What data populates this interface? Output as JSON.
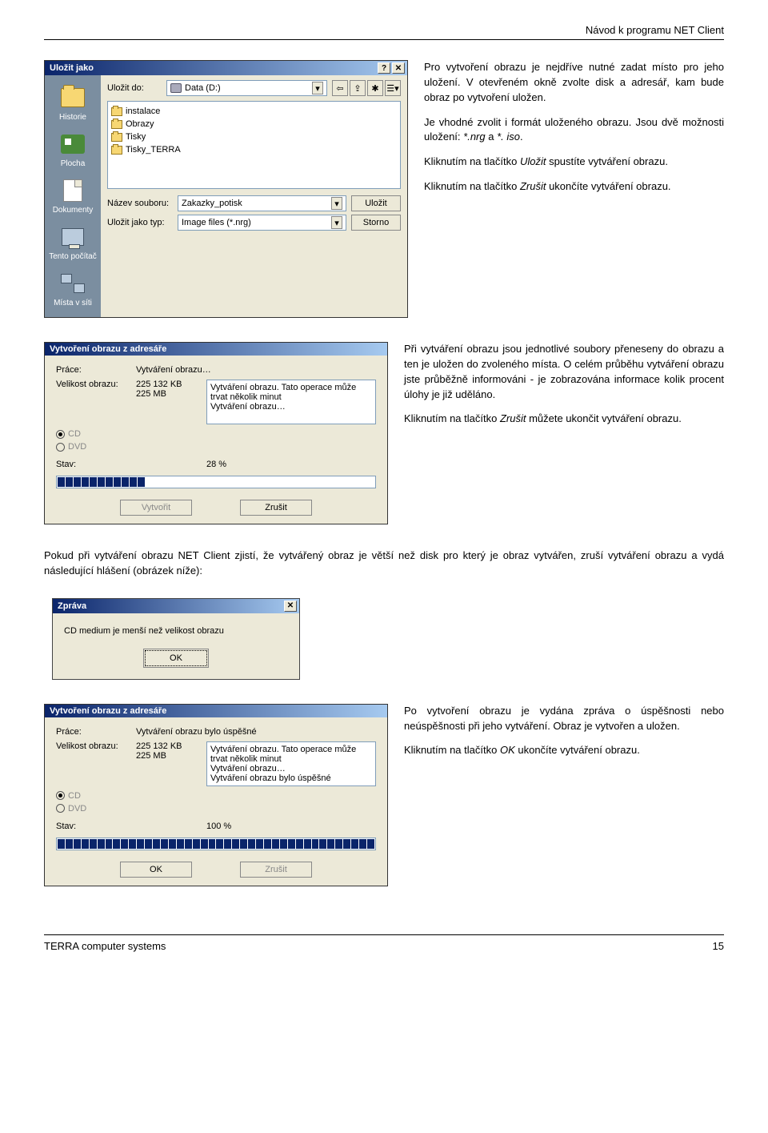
{
  "header": {
    "title": "Návod k programu NET Client"
  },
  "text": {
    "p1": "Pro vytvoření obrazu je nejdříve nutné zadat místo pro jeho uložení. V otevřeném okně zvolte disk a adresář, kam bude obraz po vytvoření uložen.",
    "p2a": "Je vhodné zvolit i formát uloženého obrazu. Jsou dvě možnosti uložení: ",
    "p2b": "*.nrg",
    "p2c": " a ",
    "p2d": "*. iso",
    "p2e": ".",
    "p3a": "Kliknutím na tlačítko ",
    "p3b": "Uložit",
    "p3c": " spustíte vytváření obrazu.",
    "p4a": "Kliknutím na tlačítko ",
    "p4b": "Zrušit",
    "p4c": " ukončíte vytváření obrazu.",
    "p5": "Při vytváření obrazu jsou jednotlivé soubory přeneseny do obrazu a ten je uložen do zvoleného místa. O celém průběhu vytváření obrazu jste průběžně informováni - je zobrazována informace kolik procent úlohy je již uděláno.",
    "p6a": "Kliknutím na tlačítko ",
    "p6b": "Zrušit",
    "p6c": " můžete ukončit vytváření obrazu.",
    "p7": "Pokud při vytváření obrazu NET Client zjistí, že vytvářený obraz je větší než disk pro který je obraz vytvářen, zruší vytváření obrazu a vydá následující hlášení (obrázek níže):",
    "p8": "Po vytvoření obrazu je vydána zpráva o úspěšnosti nebo neúspěšnosti při jeho vytváření. Obraz je vytvořen a uložen.",
    "p9a": "Kliknutím na tlačítko ",
    "p9b": "OK",
    "p9c": " ukončíte vytváření obrazu."
  },
  "saveas": {
    "title": "Uložit jako",
    "save_in_label": "Uložit do:",
    "drive": "Data (D:)",
    "places": [
      "Historie",
      "Plocha",
      "Dokumenty",
      "Tento počítač",
      "Místa v síti"
    ],
    "files": [
      "instalace",
      "Obrazy",
      "Tisky",
      "Tisky_TERRA"
    ],
    "filename_label": "Název souboru:",
    "filename": "Zakazky_potisk",
    "filetype_label": "Uložit jako typ:",
    "filetype": "Image files (*.nrg)",
    "btn_save": "Uložit",
    "btn_cancel": "Storno"
  },
  "progress": {
    "title": "Vytvoření obrazu z adresáře",
    "work_label": "Práce:",
    "work_value": "Vytváření obrazu…",
    "size_label": "Velikost obrazu:",
    "size_kb": "225 132 KB",
    "size_mb": "225 MB",
    "log_line1": "Vytváření obrazu. Tato operace  může trvat několik minut",
    "log_line2": "Vytváření obrazu…",
    "radio_cd": "CD",
    "radio_dvd": "DVD",
    "state_label": "Stav:",
    "state_value": "28 %",
    "btn_create": "Vytvořit",
    "btn_cancel": "Zrušit"
  },
  "msg": {
    "title": "Zpráva",
    "text": "CD medium je menší než velikost obrazu",
    "ok": "OK"
  },
  "done": {
    "title": "Vytvoření obrazu z adresáře",
    "work_label": "Práce:",
    "work_value": "Vytváření obrazu bylo úspěšné",
    "size_label": "Velikost obrazu:",
    "size_kb": "225 132 KB",
    "size_mb": "225 MB",
    "log_line1": "Vytváření obrazu. Tato operace  může trvat několik minut",
    "log_line2": "Vytváření obrazu…",
    "log_line3": "Vytváření obrazu bylo úspěšné",
    "radio_cd": "CD",
    "radio_dvd": "DVD",
    "state_label": "Stav:",
    "state_value": "100 %",
    "btn_ok": "OK",
    "btn_cancel": "Zrušit"
  },
  "footer": {
    "left": "TERRA computer systems",
    "right": "15"
  }
}
